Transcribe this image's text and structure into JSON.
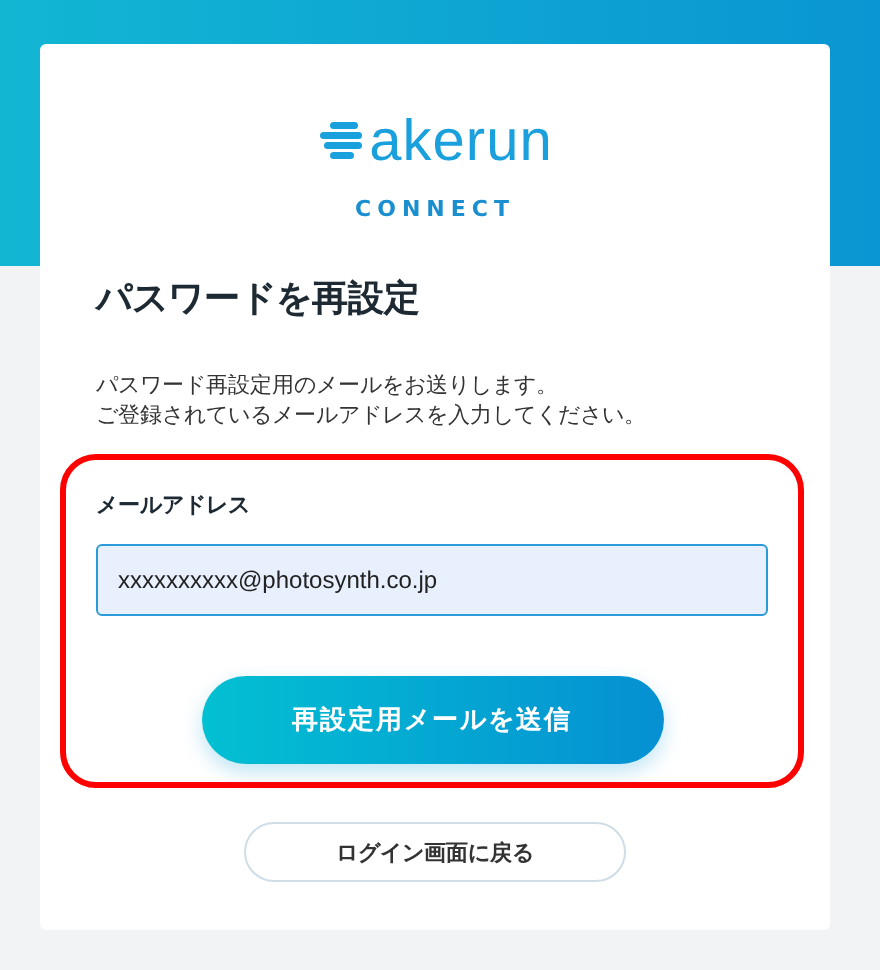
{
  "logo": {
    "wordmark": "akerun",
    "subtitle": "CONNECT"
  },
  "title": "パスワードを再設定",
  "description": [
    "パスワード再設定用のメールをお送りします。",
    "ご登録されているメールアドレスを入力してください。"
  ],
  "email_field": {
    "label": "メールアドレス",
    "value": "xxxxxxxxxx@photosynth.co.jp"
  },
  "send_button": "再設定用メールを送信",
  "back_button": "ログイン画面に戻る"
}
